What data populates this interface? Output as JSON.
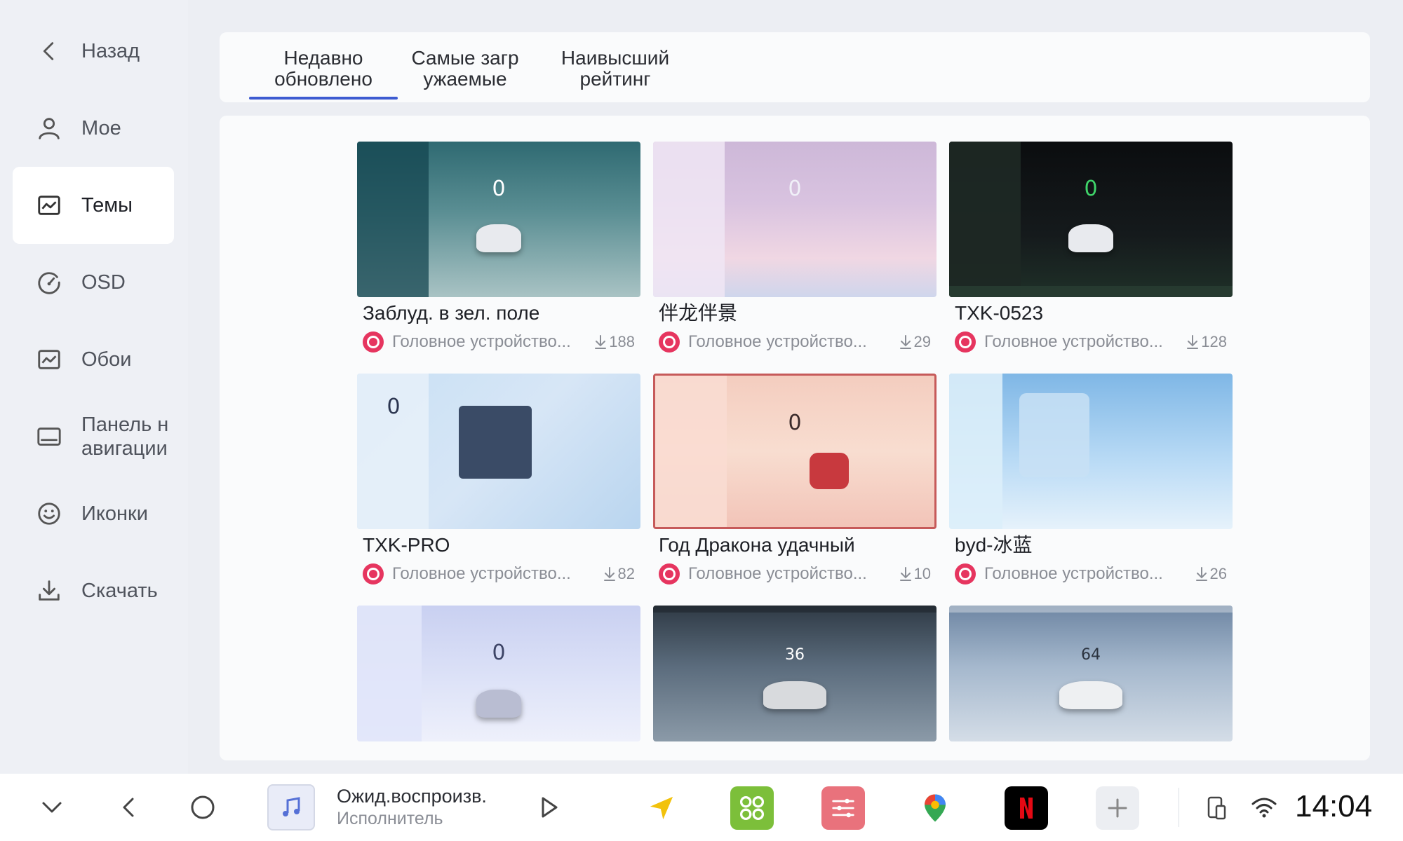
{
  "sidebar": {
    "items": [
      {
        "label": "Назад",
        "icon": "back-chevron-icon"
      },
      {
        "label": "Мое",
        "icon": "user-icon"
      },
      {
        "label": "Темы",
        "icon": "theme-icon",
        "active": true
      },
      {
        "label": "OSD",
        "icon": "gauge-icon"
      },
      {
        "label": "Обои",
        "icon": "wallpaper-icon"
      },
      {
        "label": "Панель н\nавигации",
        "icon": "navbar-icon"
      },
      {
        "label": "Иконки",
        "icon": "smiley-icon"
      },
      {
        "label": "Скачать",
        "icon": "download-icon"
      }
    ]
  },
  "tabs": [
    {
      "label": "Недавно\nобновлено",
      "active": true
    },
    {
      "label": "Самые загр\nужаемые",
      "active": false
    },
    {
      "label": "Наивысший\nрейтинг",
      "active": false
    }
  ],
  "themes": [
    {
      "title": "Заблуд. в зел. поле",
      "source": "Головное устройство...",
      "downloads": "188",
      "speed": "0"
    },
    {
      "title": "伴龙伴景",
      "source": "Головное устройство...",
      "downloads": "29",
      "speed": "0"
    },
    {
      "title": "TXK-0523",
      "source": "Головное устройство...",
      "downloads": "128",
      "speed": "0"
    },
    {
      "title": "TXK-PRO",
      "source": "Головное устройство...",
      "downloads": "82",
      "speed": "0"
    },
    {
      "title": "Год Дракона удачный",
      "source": "Головное устройство...",
      "downloads": "10",
      "speed": "0"
    },
    {
      "title": "byd-冰蓝",
      "source": "Головное устройство...",
      "downloads": "26",
      "speed": ""
    },
    {
      "title": "",
      "source": "",
      "downloads": "",
      "speed": "0"
    },
    {
      "title": "",
      "source": "",
      "downloads": "",
      "speed": "36"
    },
    {
      "title": "",
      "source": "",
      "downloads": "",
      "speed": "64"
    }
  ],
  "media": {
    "title": "Ожид.воспроизв.",
    "artist": "Исполнитель"
  },
  "status": {
    "time": "14:04"
  },
  "colors": {
    "accent": "#3d5bd1",
    "brand": "#e6355f"
  }
}
